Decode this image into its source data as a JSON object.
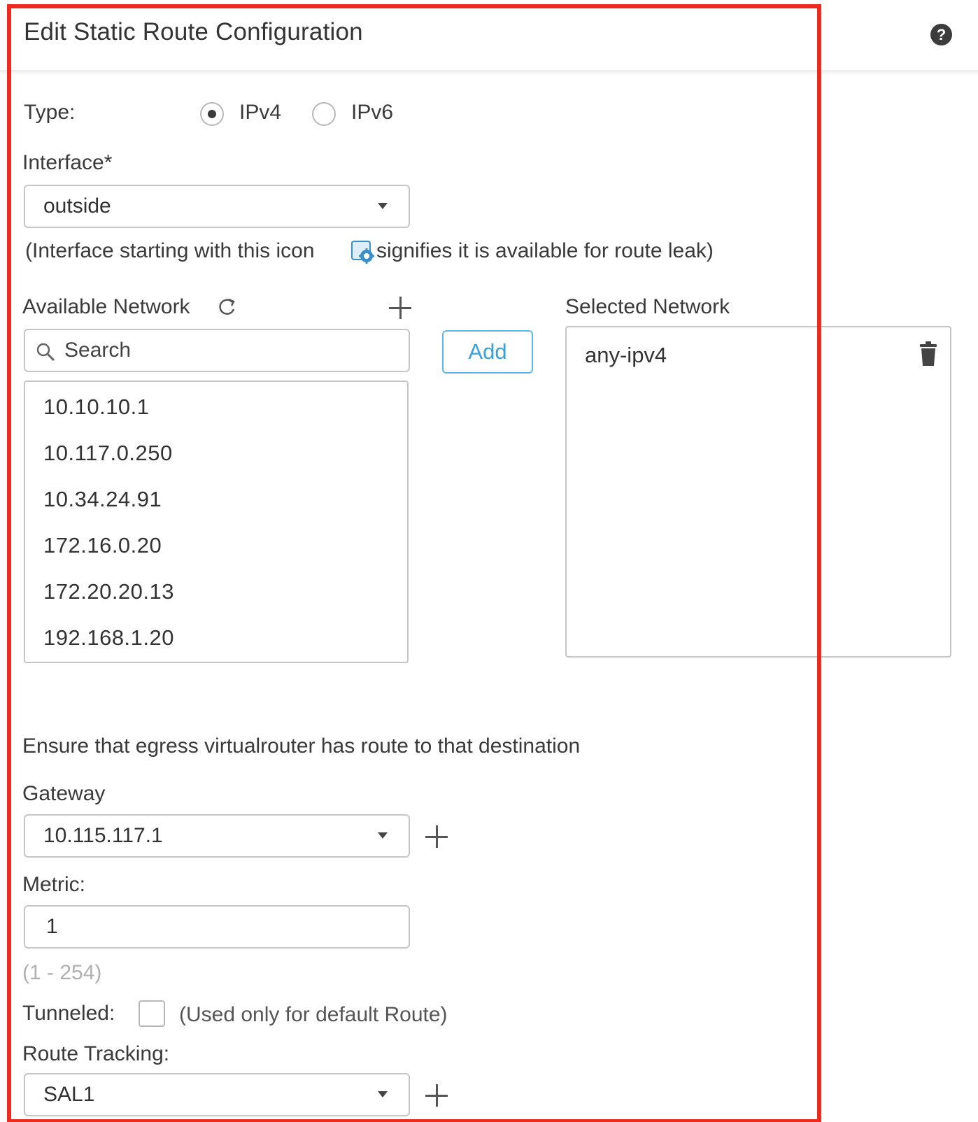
{
  "dialog": {
    "title": "Edit Static Route Configuration",
    "help_icon": "question-circle-icon"
  },
  "type": {
    "label": "Type:",
    "options": [
      {
        "label": "IPv4",
        "checked": true
      },
      {
        "label": "IPv6",
        "checked": false
      }
    ]
  },
  "interface": {
    "label": "Interface*",
    "value": "outside",
    "note_before": "(Interface starting with this icon ",
    "note_after": "signifies it is available for route leak)"
  },
  "available_network": {
    "label": "Available Network",
    "search_placeholder": "Search",
    "items": [
      "10.10.10.1",
      "10.117.0.250",
      "10.34.24.91",
      "172.16.0.20",
      "172.20.20.13",
      "192.168.1.20"
    ]
  },
  "add_button": "Add",
  "selected_network": {
    "label": "Selected Network",
    "items": [
      "any-ipv4"
    ]
  },
  "egress_note": "Ensure that egress virtualrouter has route to that destination",
  "gateway": {
    "label": "Gateway",
    "value": "10.115.117.1"
  },
  "metric": {
    "label": "Metric:",
    "value": "1",
    "range_hint": "(1 - 254)"
  },
  "tunneled": {
    "label": "Tunneled:",
    "checked": false,
    "hint": "(Used only for default Route)"
  },
  "route_tracking": {
    "label": "Route Tracking:",
    "value": "SAL1"
  },
  "colors": {
    "highlight": "#ee2a1e",
    "accent": "#3aa0d8"
  }
}
